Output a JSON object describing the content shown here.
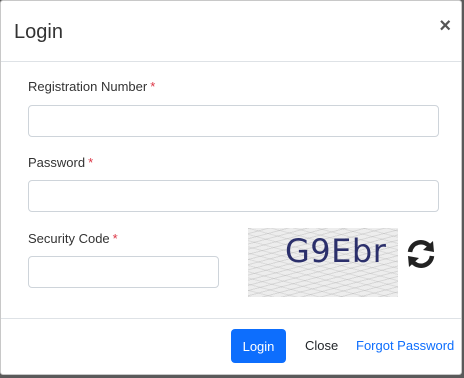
{
  "modal": {
    "title": "Login",
    "close_symbol": "×"
  },
  "form": {
    "registration": {
      "label": "Registration Number",
      "required_mark": "*",
      "value": ""
    },
    "password": {
      "label": "Password",
      "required_mark": "*",
      "value": ""
    },
    "security_code": {
      "label": "Security Code",
      "required_mark": "*",
      "value": ""
    }
  },
  "captcha": {
    "text": "G9Ebr",
    "refresh_icon": "refresh-icon"
  },
  "footer": {
    "login_label": "Login",
    "close_label": "Close",
    "forgot_label": "Forgot Password"
  },
  "colors": {
    "primary": "#0d6efd",
    "required": "#dc3545",
    "captcha_text": "#2b2f6b"
  }
}
